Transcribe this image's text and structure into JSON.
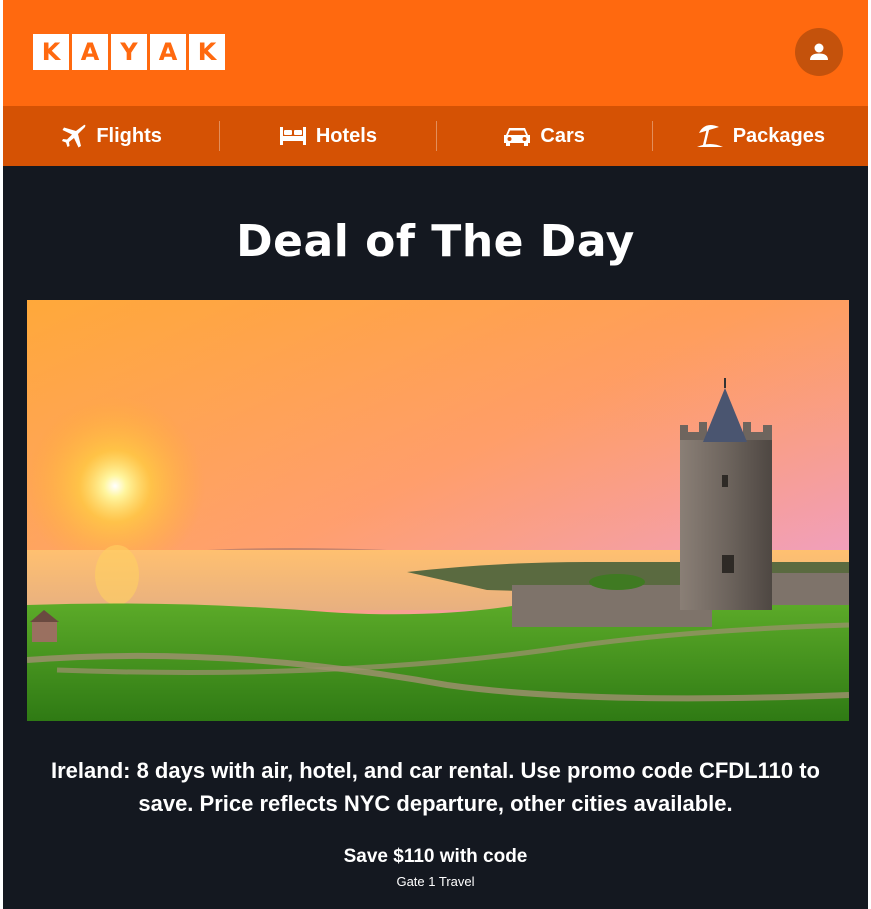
{
  "brand": {
    "letters": [
      "K",
      "A",
      "Y",
      "A",
      "K"
    ],
    "color": "#ff690f"
  },
  "header": {
    "profile_icon": "user-icon"
  },
  "nav": {
    "items": [
      {
        "label": "Flights",
        "icon": "airplane-icon"
      },
      {
        "label": "Hotels",
        "icon": "bed-icon"
      },
      {
        "label": "Cars",
        "icon": "car-icon"
      },
      {
        "label": "Packages",
        "icon": "beach-umbrella-icon"
      }
    ]
  },
  "deal": {
    "title": "Deal of The Day",
    "description": "Ireland: 8 days with air, hotel, and car rental. Use promo code CFDL110 to save. Price reflects NYC departure, other cities available.",
    "save_text": "Save $110 with code",
    "provider": "Gate 1 Travel"
  },
  "colors": {
    "nav_bg": "#d55204",
    "content_bg": "#141820"
  }
}
